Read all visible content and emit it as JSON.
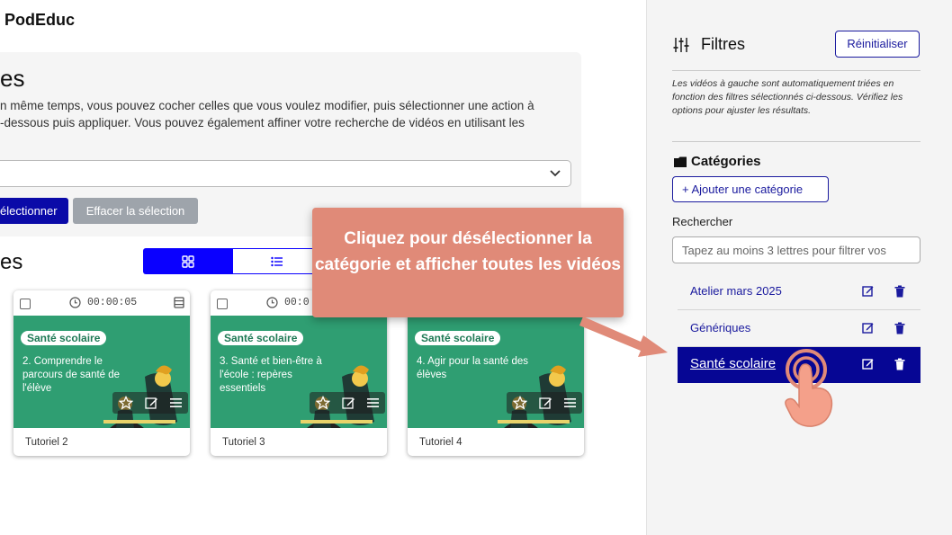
{
  "header": {
    "brand": "PodEduc"
  },
  "intro": {
    "title_partial": "es",
    "text": "n même temps, vous pouvez cocher celles que vous voulez modifier, puis sélectionner une action à\n-dessous puis appliquer. Vous pouvez également affiner votre recherche de vidéos en utilisant les",
    "select_all_label": "électionner",
    "clear_selection_label": "Effacer la sélection"
  },
  "videos": {
    "title_partial": "es",
    "cards": [
      {
        "duration": "00:00:05",
        "badge": "Santé scolaire",
        "thumb_text": "2. Comprendre le parcours de santé de l'élève",
        "title": "Tutoriel 2"
      },
      {
        "duration": "00:0",
        "badge": "Santé scolaire",
        "thumb_text": "3. Santé et bien-être à l'école : repères essentiels",
        "title": "Tutoriel 3"
      },
      {
        "duration": "",
        "badge": "Santé scolaire",
        "thumb_text": "4. Agir pour la santé des élèves",
        "title": "Tutoriel 4"
      }
    ]
  },
  "sidebar": {
    "title": "Filtres",
    "reset_label": "Réinitialiser",
    "note": "Les vidéos à gauche sont automatiquement triées en fonction des filtres sélectionnés ci-dessous. Vérifiez les options pour ajuster les résultats.",
    "categories_title": "Catégories",
    "add_category_label": "+ Ajouter une catégorie",
    "search_label": "Rechercher",
    "search_placeholder": "Tapez au moins 3 lettres pour filtrer vos",
    "categories": [
      {
        "label": "Atelier mars 2025",
        "active": false
      },
      {
        "label": "Génériques",
        "active": false
      },
      {
        "label": "Santé scolaire",
        "active": true
      }
    ]
  },
  "tutorial": {
    "callout_text": "Cliquez pour désélectionner la catégorie et afficher toutes les vidéos",
    "callout_color": "#e08a78"
  },
  "colors": {
    "primary": "#0a0aa8",
    "toggle_active": "#0a00ff",
    "thumbnail": "#2f9e72",
    "active_category": "#060694"
  }
}
